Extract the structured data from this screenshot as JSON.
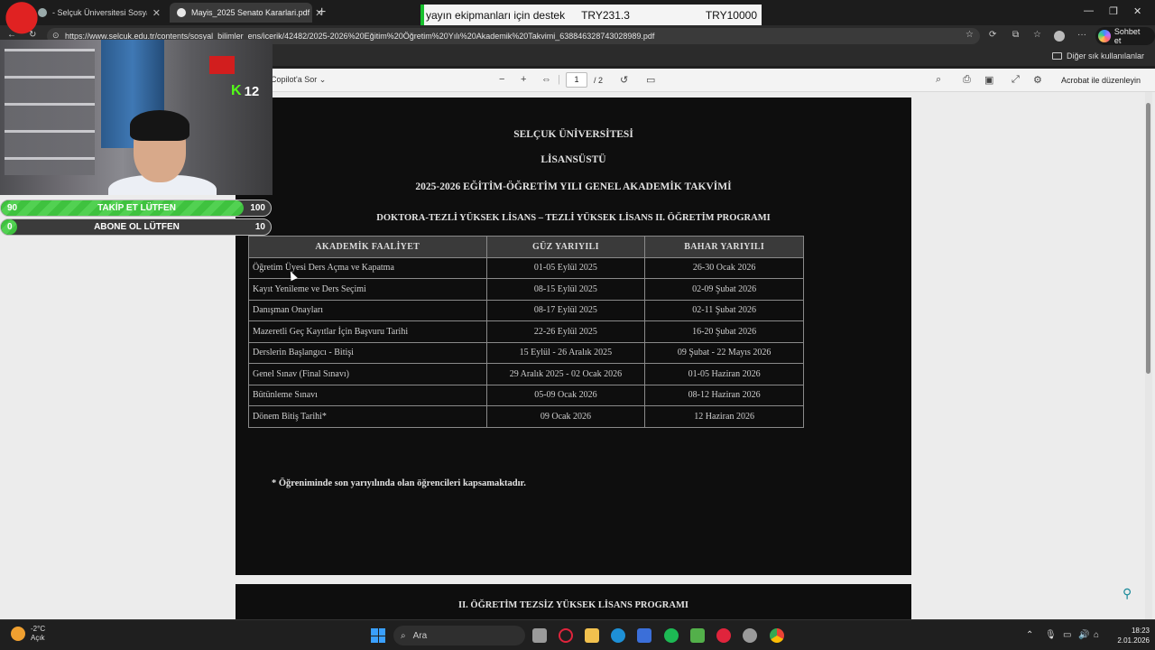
{
  "browser": {
    "tabs": [
      {
        "label": "- Selçuk Üniversitesi Sosyal Bilim"
      },
      {
        "label": "Mayis_2025 Senato Kararlari.pdf"
      }
    ],
    "url": "https://www.selcuk.edu.tr/contents/sosyal_bilimler_ens/icerik/42482/2025-2026%20Eğitim%20Öğretim%20Yılı%20Akademik%20Takvimi_638846328743028989.pdf",
    "copilot_label": "Sohbet et",
    "favorites_other": "Diğer sık kullanılanlar"
  },
  "donation": {
    "text": "yayın ekipmanları için destek",
    "current": "TRY231.3",
    "goal": "TRY10000"
  },
  "pdf_toolbar": {
    "copilot_ask": "Copilot'a Sor",
    "page_current": "1",
    "page_total": "/ 2",
    "acrobat_label": "Acrobat ile düzenleyin"
  },
  "document": {
    "university": "SELÇUK ÜNİVERSİTESİ",
    "level": "LİSANSÜSTÜ",
    "calendar_title": "2025-2026 EĞİTİM-ÖĞRETİM YILI GENEL AKADEMİK TAKVİMİ",
    "program_title": "DOKTORA-TEZLİ YÜKSEK LİSANS – TEZLİ YÜKSEK LİSANS II. ÖĞRETİM PROGRAMI",
    "table_headers": [
      "AKADEMİK FAALİYET",
      "GÜZ YARIYILI",
      "BAHAR YARIYILI"
    ],
    "rows": [
      [
        "Öğretim Üyesi Ders Açma ve Kapatma",
        "01-05 Eylül 2025",
        "26-30 Ocak 2026"
      ],
      [
        "Kayıt Yenileme ve Ders Seçimi",
        "08-15 Eylül 2025",
        "02-09 Şubat 2026"
      ],
      [
        "Danışman Onayları",
        "08-17 Eylül 2025",
        "02-11 Şubat 2026"
      ],
      [
        "Mazeretli Geç Kayıtlar İçin Başvuru Tarihi",
        "22-26 Eylül 2025",
        "16-20 Şubat 2026"
      ],
      [
        "Derslerin Başlangıcı - Bitişi",
        "15 Eylül - 26 Aralık 2025",
        "09 Şubat - 22 Mayıs 2026"
      ],
      [
        "Genel Sınav (Final Sınavı)",
        "29 Aralık 2025 - 02 Ocak 2026",
        "01-05 Haziran 2026"
      ],
      [
        "Bütünleme Sınavı",
        "05-09 Ocak 2026",
        "08-12 Haziran 2026"
      ],
      [
        "Dönem Bitiş Tarihi*",
        "09 Ocak 2026",
        "12 Haziran 2026"
      ]
    ],
    "footnote": "* Öğreniminde son yarıyılında olan öğrencileri kapsamaktadır.",
    "page2_title": "II. ÖĞRETİM TEZSİZ YÜKSEK LİSANS PROGRAMI"
  },
  "stream": {
    "viewer_count": "12",
    "follow_goal": {
      "start": "90",
      "label": "TAKİP ET LÜTFEN",
      "target": "100",
      "progress": 0.9
    },
    "sub_goal": {
      "start": "0",
      "label": "ABONE OL LÜTFEN",
      "target": "10",
      "progress": 0.0
    }
  },
  "taskbar": {
    "weather_temp": "-2°C",
    "weather_desc": "Açık",
    "search_placeholder": "Ara",
    "time": "18:23",
    "date": "2.01.2026"
  },
  "colors": {
    "goal_fill": "#3fc23f",
    "donation_bar": "#17c02d",
    "kick_green": "#53fc18"
  }
}
